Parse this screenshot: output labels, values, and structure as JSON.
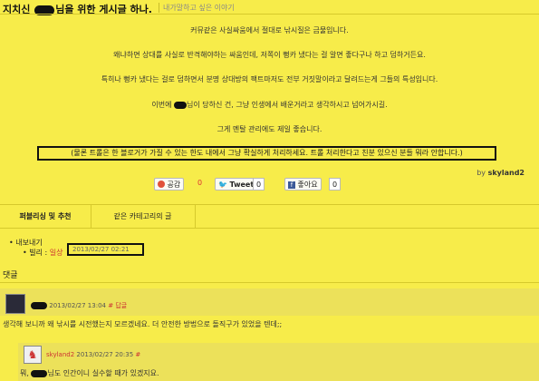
{
  "post": {
    "title_before": "지치신",
    "title_after": "님을 위한 게시글 하나.",
    "category": "내가말하고 싶은 이야기"
  },
  "body": {
    "p1": "커뮤같은 사실싸움에서 절대로 낚시질은 금물입니다.",
    "p2": "왜냐하면 상대를 사실로 반격해야하는 싸움인데, 저쪽이 뻥카 냈다는 걸 알면 좋다구나 하고 덤하거든요.",
    "p3": "특히나 뻥카 냈다는 걸로 덤하면서 분명 상대방의 팩트마저도 전부 거짓말이라고 달려드는게 그들의 특성입니다.",
    "p4_before": "이번에",
    "p4_after": "님이 당하신 건, 그냥 인생에서 배운거라고 생각하시고 넘어가시길.",
    "p5": "그게 멘탈 관리에도 제일 좋습니다.",
    "boxed": "(물론 트롤은 한 블로거가 가질 수 있는 한도 내에서 그냥 확실하게 처리하세요. 트롤 처리한다고 친분 있으신 분들 뭐라 안합니다.)"
  },
  "byline": {
    "by": "by",
    "author": "skyland2"
  },
  "actions": {
    "like_label": "공감",
    "like_count": "0",
    "tweet_label": "Tweet",
    "tweet_count": "0",
    "fb_label": "좋아요",
    "fb_count": "0"
  },
  "tabs": {
    "tab1": "퍼블리싱 및 추천",
    "tab2": "같은 카테고리의 글"
  },
  "export": {
    "label": "내보내기",
    "sub_label": "빌리 :",
    "sub_value": "일상",
    "timestamp": "2013/02/27 02:21"
  },
  "comments": {
    "heading": "댓글",
    "c1": {
      "meta": "2013/02/27 13:04",
      "hash": "#",
      "reply": "답글",
      "text": "생각해 보니까 왜 낚시를 시전했는지 모르겠네요. 더 안전한 방법으로 돌직구가 있었을 텐데;;"
    },
    "c2": {
      "author": "skyland2",
      "meta": "2013/02/27 20:35",
      "hash": "#",
      "text_before": "뭐,",
      "text_after": "님도 인간이니 실수할 때가 있겠지요."
    }
  },
  "colors": {
    "background": "#f7ec4a",
    "accent_red": "#cc3333",
    "twitter": "#1da1f2",
    "facebook": "#3b5998"
  }
}
